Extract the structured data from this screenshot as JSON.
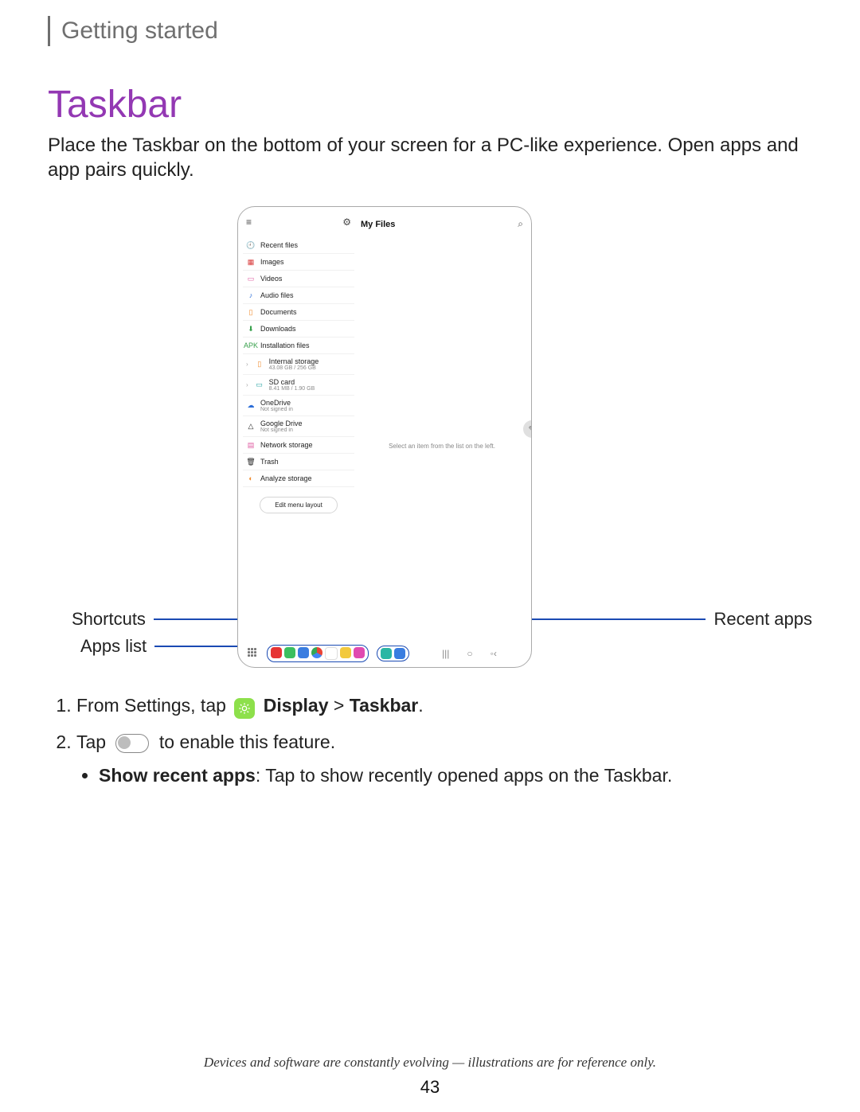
{
  "breadcrumb": "Getting started",
  "title": "Taskbar",
  "lead": "Place the Taskbar on the bottom of your screen for a PC-like experience. Open apps and app pairs quickly.",
  "callouts": {
    "shortcuts": "Shortcuts",
    "apps_list": "Apps list",
    "recent": "Recent apps"
  },
  "device": {
    "app_title": "My Files",
    "content_hint": "Select an item from the list on the left.",
    "edit_button": "Edit menu layout",
    "sidebar_items": [
      {
        "icon": "🕘",
        "cls": "c-orange",
        "label": "Recent files"
      },
      {
        "icon": "▦",
        "cls": "c-red",
        "label": "Images"
      },
      {
        "icon": "▭",
        "cls": "c-pink",
        "label": "Videos"
      },
      {
        "icon": "♪",
        "cls": "c-blue",
        "label": "Audio files"
      },
      {
        "icon": "▯",
        "cls": "c-orange",
        "label": "Documents"
      },
      {
        "icon": "⬇",
        "cls": "c-green",
        "label": "Downloads"
      },
      {
        "icon": "APK",
        "cls": "c-green",
        "label": "Installation files"
      },
      {
        "icon": "▯",
        "cls": "c-orange",
        "label": "Internal storage",
        "sub": "43.08 GB / 256 GB",
        "chev": true
      },
      {
        "icon": "▭",
        "cls": "c-teal",
        "label": "SD card",
        "sub": "8.41 MB / 1.90 GB",
        "chev": true
      },
      {
        "icon": "☁",
        "cls": "c-blue",
        "label": "OneDrive",
        "sub": "Not signed in"
      },
      {
        "icon": "△",
        "cls": "",
        "label": "Google Drive",
        "sub": "Not signed in"
      },
      {
        "icon": "▤",
        "cls": "c-pink",
        "label": "Network storage"
      },
      {
        "icon": "🗑",
        "cls": "",
        "label": "Trash"
      },
      {
        "icon": "◐",
        "cls": "c-orange",
        "label": "Analyze storage"
      }
    ]
  },
  "steps": {
    "s1_a": "From Settings, tap",
    "s1_b": "Display",
    "s1_c": "Taskbar",
    "s2_a": "Tap",
    "s2_b": "to enable this feature.",
    "bullet_label": "Show recent apps",
    "bullet_rest": ": Tap to show recently opened apps on the Taskbar."
  },
  "footnote": "Devices and software are constantly evolving — illustrations are for reference only.",
  "page_number": "43"
}
